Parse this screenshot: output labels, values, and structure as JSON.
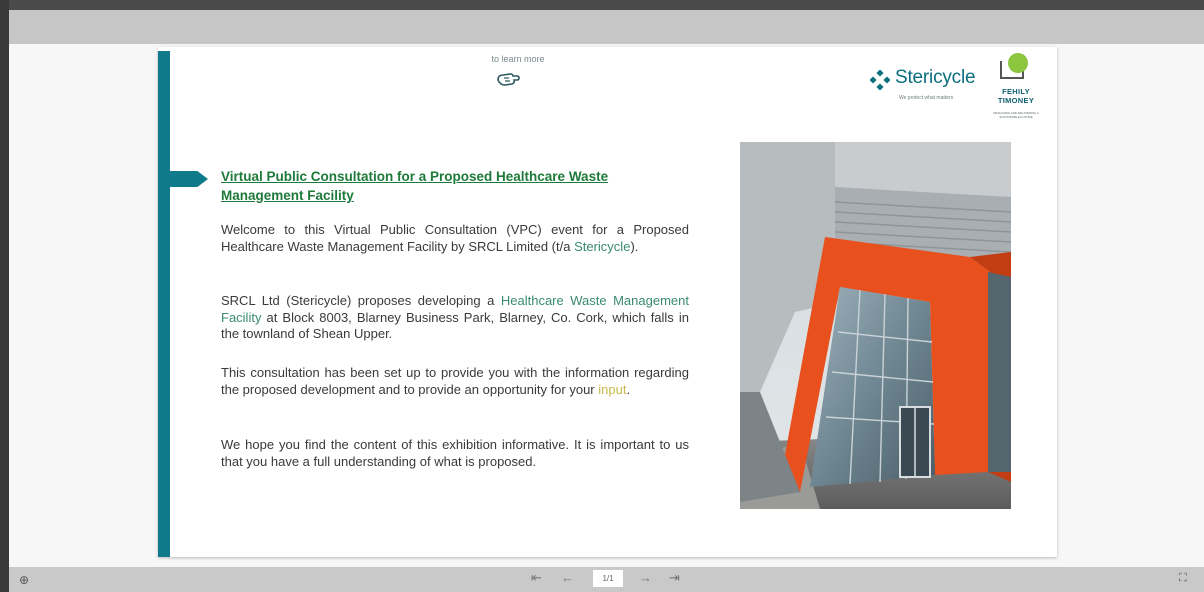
{
  "viewer": {
    "page_indicator": "1/1"
  },
  "slide": {
    "learn_more": "to learn more",
    "title": "Virtual Public Consultation for a Proposed Healthcare Waste Management Facility",
    "paragraphs": {
      "p1_a": "Welcome to this Virtual Public Consultation (VPC) event for a Proposed Healthcare Waste Management Facility by SRCL Limited (t/a ",
      "p1_link": "Stericycle",
      "p1_b": ").",
      "p2_a": "SRCL Ltd  (Stericycle) proposes developing a ",
      "p2_link": "Healthcare Waste Management Facility",
      "p2_b": " at Block 8003, Blarney Business Park, Blarney, Co. Cork, which falls in the townland of Shean Upper.",
      "p3_a": "This consultation has been set up to provide you with the information regarding the proposed development and to provide an opportunity for your ",
      "p3_link": "input",
      "p3_b": ".",
      "p4": "We hope you find the content of this exhibition informative. It is important to us that you have a full understanding of what is proposed."
    }
  },
  "logos": {
    "stericycle": {
      "name": "Stericycle",
      "tagline": "We protect what matters"
    },
    "fehily_timoney": {
      "line1": "FEHILY",
      "line2": "TIMONEY",
      "sub": "DESIGNING AND DELIVERING A SUSTAINABLE FUTURE"
    }
  },
  "colors": {
    "accent_teal": "#0f7b8a",
    "title_green": "#1e7a3a",
    "link_green": "#3a8a72",
    "link_yellow": "#c9b84a",
    "building_orange": "#e8501e"
  },
  "icons": {
    "zoom": "zoom-icon",
    "first": "first-page-icon",
    "prev": "previous-page-icon",
    "next": "next-page-icon",
    "last": "last-page-icon",
    "fullscreen": "fullscreen-icon",
    "hand": "pointing-hand-icon"
  }
}
